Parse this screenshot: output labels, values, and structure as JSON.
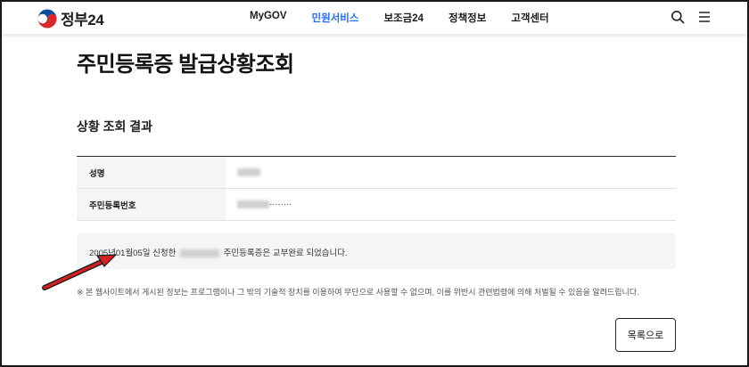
{
  "header": {
    "logo_text": "정부24",
    "nav": [
      {
        "label": "MyGOV",
        "active": false
      },
      {
        "label": "민원서비스",
        "active": true
      },
      {
        "label": "보조금24",
        "active": false
      },
      {
        "label": "정책정보",
        "active": false
      },
      {
        "label": "고객센터",
        "active": false
      }
    ],
    "icons": [
      "search-icon",
      "menu-icon"
    ]
  },
  "page": {
    "title": "주민등록증 발급상황조회",
    "section_title": "상황 조회 결과"
  },
  "info_table": [
    {
      "label": "성명",
      "value": ""
    },
    {
      "label": "주민등록번호",
      "value": "-·······"
    }
  ],
  "result": {
    "prefix": "2005년01월05일 신청한",
    "suffix": "주민등록증은 교부완료 되었습니다."
  },
  "notice": "※ 본 웹사이트에서 게시된 정보는 프로그램이나 그 밖의 기술적 장치를 이용하여 무단으로 사용할 수 없으며, 이를 위반시 관련법령에 의해 처벌될 수 있음을 알려드립니다.",
  "buttons": {
    "list": "목록으로"
  },
  "colors": {
    "accent": "#256ef4",
    "annotation_arrow": "#d42020"
  }
}
